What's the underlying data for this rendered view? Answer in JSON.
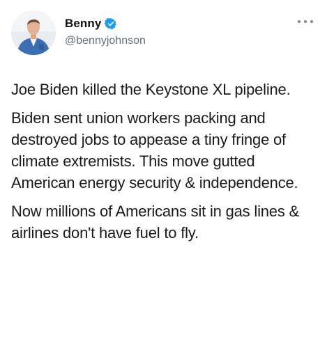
{
  "tweet": {
    "author": {
      "display_name": "Benny",
      "handle": "@bennyjohnson",
      "verified_icon": "verified-badge-icon",
      "avatar_icon": "avatar"
    },
    "menu_icon": "more-options-icon",
    "paragraphs": [
      "Joe Biden killed the Keystone XL pipeline.",
      "Biden sent union workers packing and destroyed jobs to appease a tiny fringe of climate extremists. This move gutted American energy security & independence.",
      "Now millions of Americans sit in gas lines & airlines don't have fuel to fly."
    ]
  },
  "colors": {
    "verified_blue": "#1d9bf0",
    "handle_gray": "#65707b",
    "text": "#1a1a1a"
  }
}
